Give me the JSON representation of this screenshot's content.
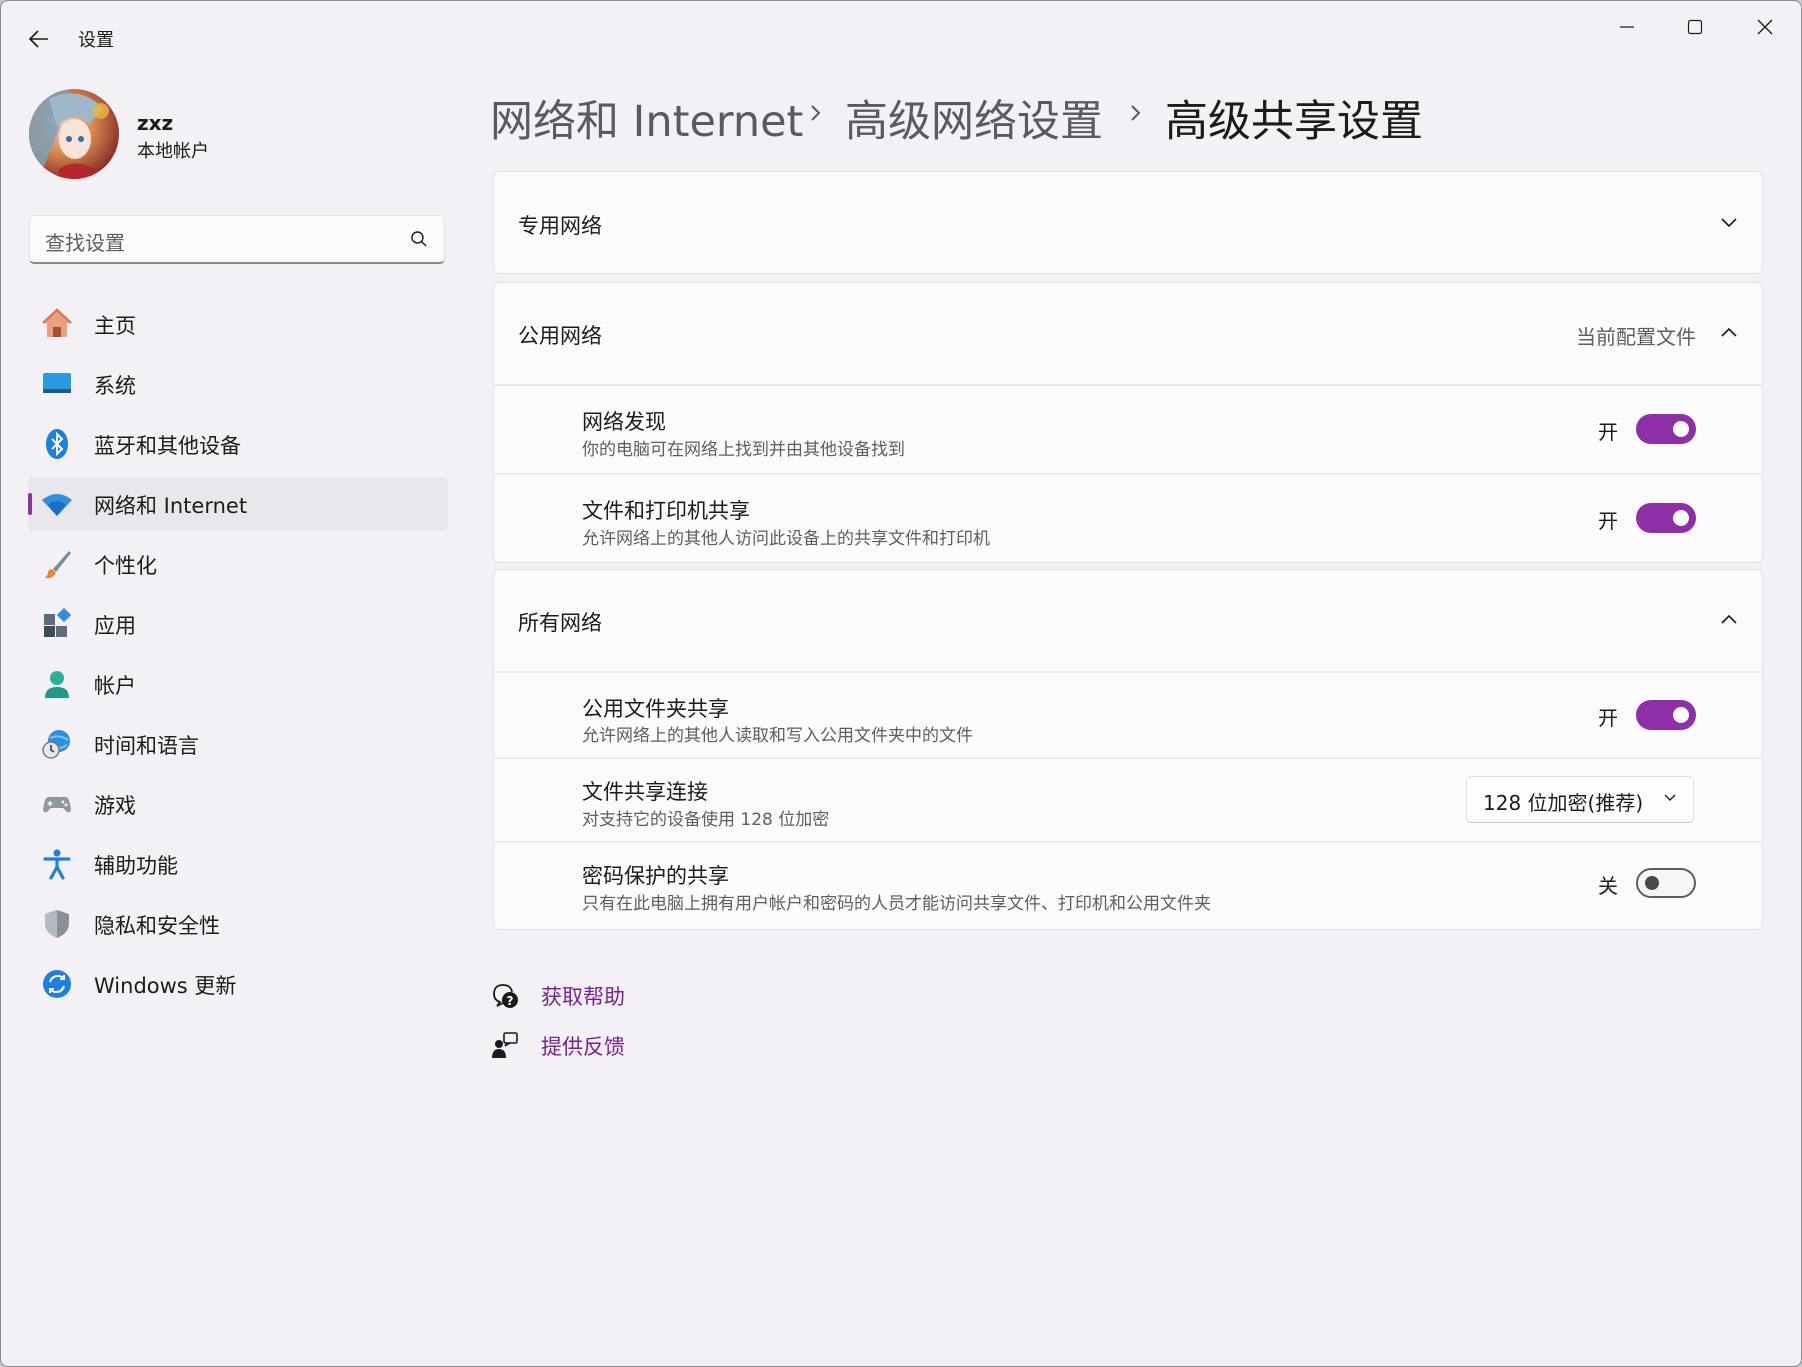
{
  "window": {
    "title": "设置",
    "controls": {
      "minimize": "minimize",
      "maximize": "maximize",
      "close": "close"
    }
  },
  "user": {
    "name": "zxz",
    "account_type": "本地帐户"
  },
  "search": {
    "placeholder": "查找设置"
  },
  "sidebar": {
    "items": [
      {
        "label": "主页",
        "icon": "home-icon"
      },
      {
        "label": "系统",
        "icon": "system-display-icon"
      },
      {
        "label": "蓝牙和其他设备",
        "icon": "bluetooth-icon"
      },
      {
        "label": "网络和 Internet",
        "icon": "wifi-icon",
        "active": true
      },
      {
        "label": "个性化",
        "icon": "brush-icon"
      },
      {
        "label": "应用",
        "icon": "apps-icon"
      },
      {
        "label": "帐户",
        "icon": "account-icon"
      },
      {
        "label": "时间和语言",
        "icon": "globe-clock-icon"
      },
      {
        "label": "游戏",
        "icon": "gamepad-icon"
      },
      {
        "label": "辅助功能",
        "icon": "accessibility-icon"
      },
      {
        "label": "隐私和安全性",
        "icon": "shield-icon"
      },
      {
        "label": "Windows 更新",
        "icon": "update-icon"
      }
    ]
  },
  "breadcrumb": {
    "items": [
      "网络和 Internet",
      "高级网络设置",
      "高级共享设置"
    ]
  },
  "sections": {
    "private": {
      "label": "专用网络"
    },
    "public": {
      "label": "公用网络",
      "status": "当前配置文件",
      "items": [
        {
          "title": "网络发现",
          "desc": "你的电脑可在网络上找到并由其他设备找到",
          "state": "开",
          "on": true
        },
        {
          "title": "文件和打印机共享",
          "desc": "允许网络上的其他人访问此设备上的共享文件和打印机",
          "state": "开",
          "on": true
        }
      ]
    },
    "all": {
      "label": "所有网络",
      "items": [
        {
          "title": "公用文件夹共享",
          "desc": "允许网络上的其他人读取和写入公用文件夹中的文件",
          "state": "开",
          "on": true
        },
        {
          "title": "文件共享连接",
          "desc": "对支持它的设备使用 128 位加密",
          "dropdown_value": "128 位加密(推荐)"
        },
        {
          "title": "密码保护的共享",
          "desc": "只有在此电脑上拥有用户帐户和密码的人员才能访问共享文件、打印机和公用文件夹",
          "state": "关",
          "on": false
        }
      ]
    }
  },
  "links": {
    "help": "获取帮助",
    "feedback": "提供反馈"
  },
  "colors": {
    "accent": "#8e2fa7",
    "link": "#7a2294",
    "background": "#f3f0f6",
    "card": "#fbfafc"
  }
}
